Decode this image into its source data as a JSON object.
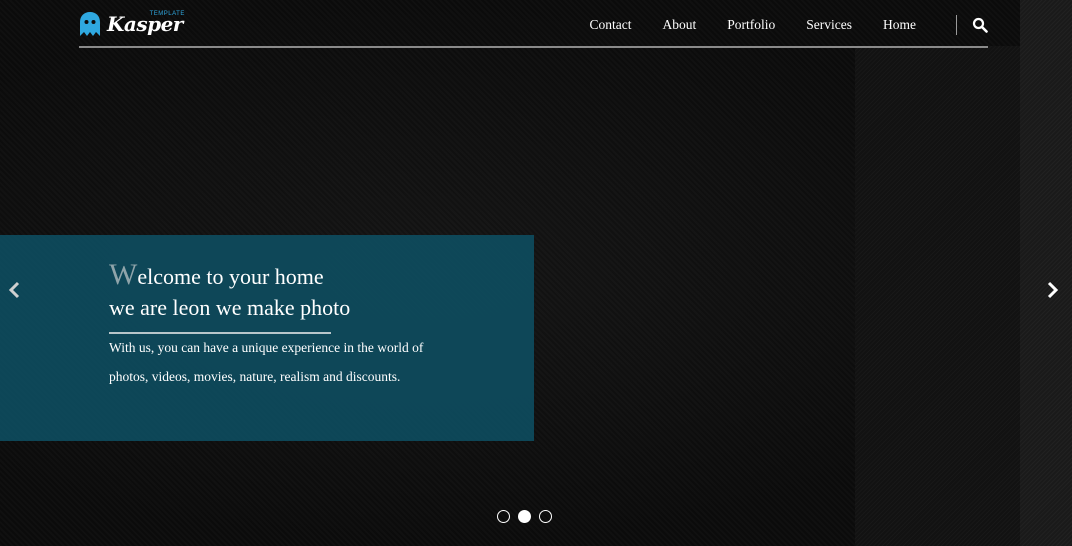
{
  "brand": {
    "name": "Kasper",
    "tag": "TEMPLATE",
    "logo_icon": "ghost-icon",
    "accent_color": "#2fa8e0"
  },
  "nav": {
    "items": [
      {
        "label": "Contact"
      },
      {
        "label": "About"
      },
      {
        "label": "Portfolio"
      },
      {
        "label": "Services"
      },
      {
        "label": "Home"
      }
    ],
    "search_icon": "search-icon"
  },
  "slide": {
    "title_first_letter": "W",
    "title_rest_line1": "elcome to your home",
    "title_line2": "we are leon we make photo",
    "body": "With us, you can have a unique experience in the world of photos, videos, movies, nature, realism and discounts.",
    "panel_color": "#0e4e62"
  },
  "carousel": {
    "prev_icon": "chevron-left-icon",
    "next_icon": "chevron-right-icon",
    "slide_count": 3,
    "active_index": 1
  }
}
